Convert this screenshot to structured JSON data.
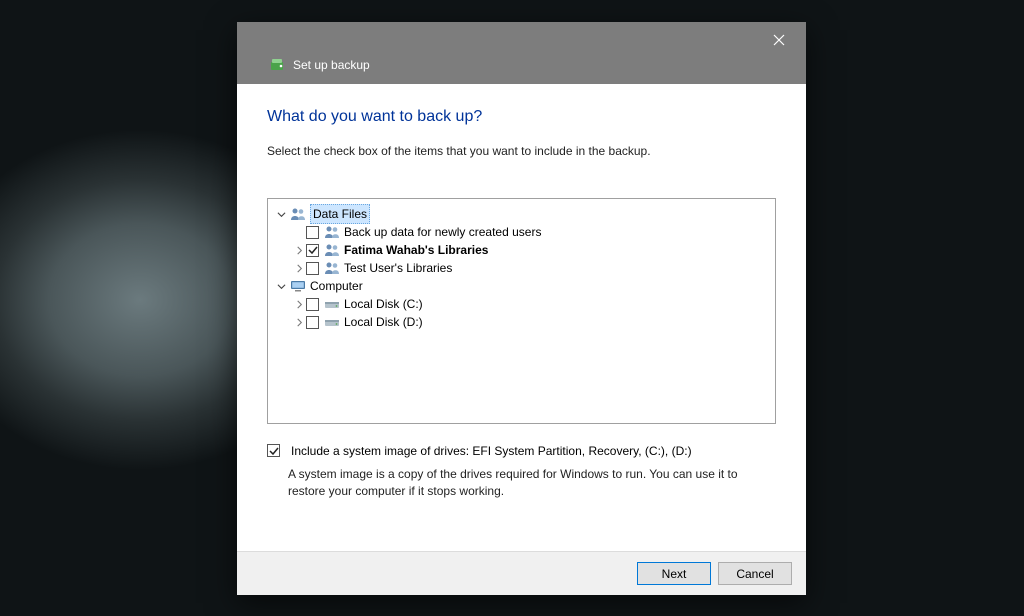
{
  "window": {
    "title": "Set up backup"
  },
  "page": {
    "heading": "What do you want to back up?",
    "subheading": "Select the check box of the items that you want to include in the backup."
  },
  "tree": {
    "dataFiles": {
      "label": "Data Files",
      "items": {
        "newUsers": "Back up data for newly created users",
        "fatima": "Fatima Wahab's Libraries",
        "testUser": "Test User's Libraries"
      }
    },
    "computer": {
      "label": "Computer",
      "drives": {
        "c": "Local Disk (C:)",
        "d": "Local Disk (D:)"
      }
    }
  },
  "include": {
    "label": "Include a system image of drives: EFI System Partition, Recovery, (C:), (D:)",
    "description": "A system image is a copy of the drives required for Windows to run. You can use it to restore your computer if it stops working."
  },
  "buttons": {
    "next": "Next",
    "cancel": "Cancel"
  }
}
